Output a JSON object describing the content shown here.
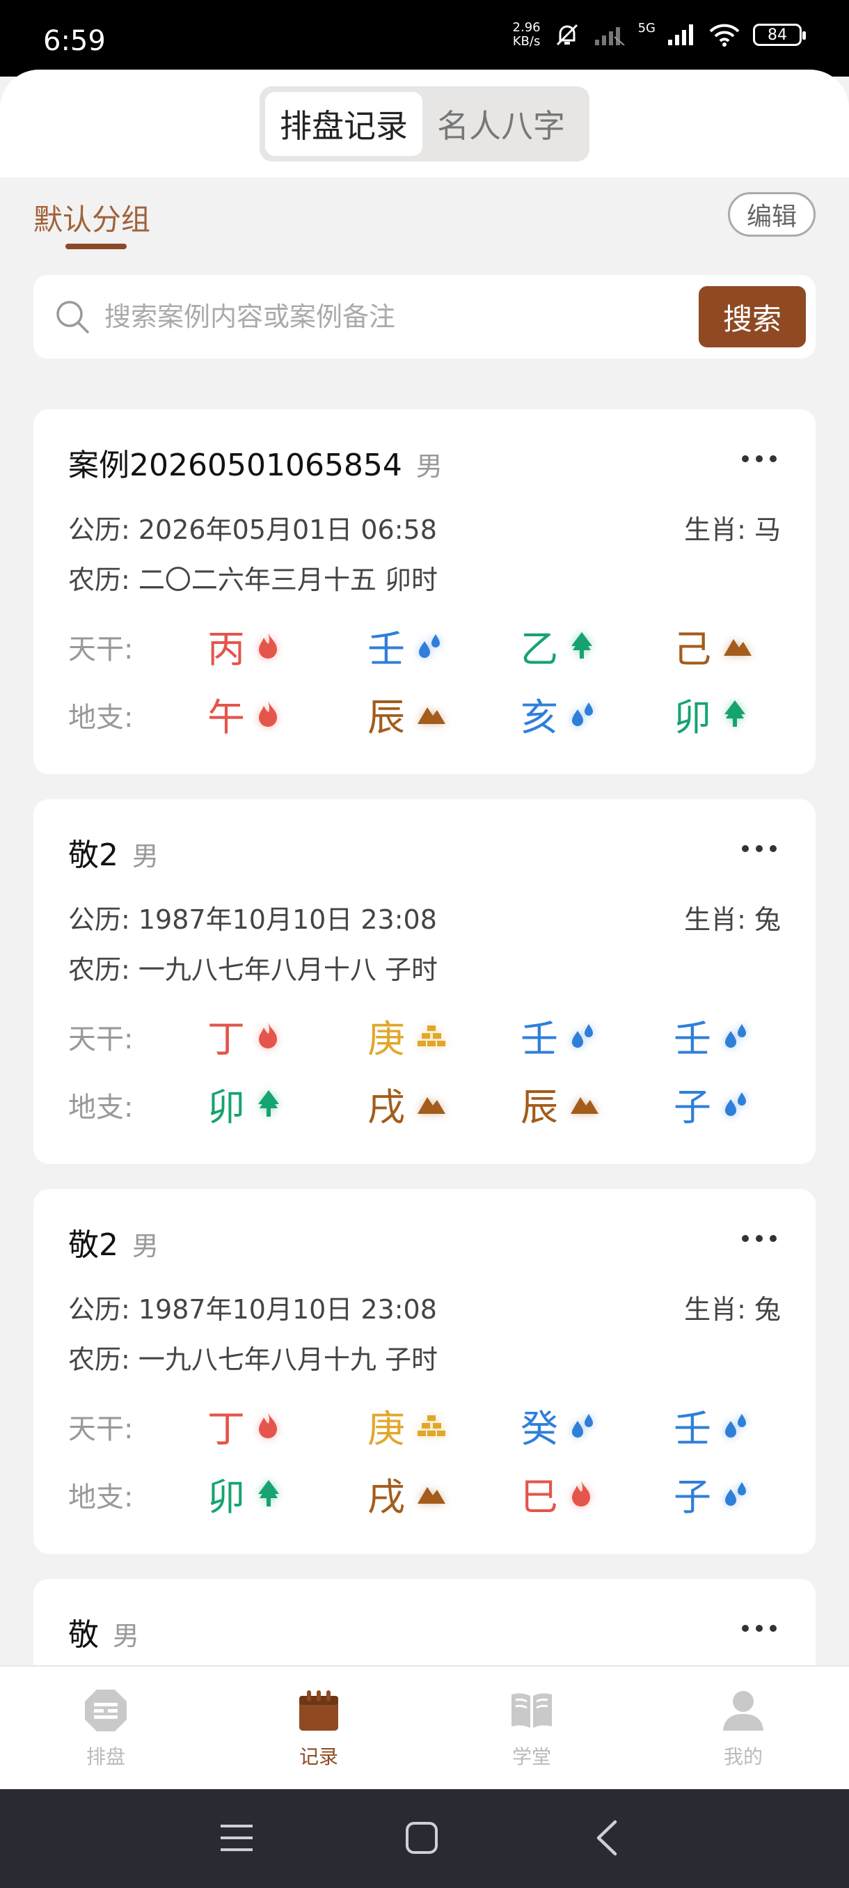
{
  "status": {
    "time": "6:59",
    "net_speed_value": "2.96",
    "net_speed_unit": "KB/s",
    "network": "5G",
    "battery": "84"
  },
  "tabs": [
    {
      "label": "排盘记录",
      "active": true
    },
    {
      "label": "名人八字",
      "active": false
    }
  ],
  "group": {
    "label": "默认分组",
    "edit_label": "编辑"
  },
  "search": {
    "placeholder": "搜索案例内容或案例备注",
    "button_label": "搜索"
  },
  "labels": {
    "gan": "天干:",
    "zhi": "地支:"
  },
  "element_colors": {
    "fire": "#e4554b",
    "water": "#2f7fd9",
    "wood": "#16a36f",
    "earth": "#a35c1c",
    "metal": "#e0a72a"
  },
  "cards": [
    {
      "title": "案例20260501065854",
      "gender": "男",
      "solar": "公历: 2026年05月01日 06:58",
      "zodiac": "生肖: 马",
      "lunar": "农历: 二〇二六年三月十五  卯时",
      "gan": [
        {
          "char": "丙",
          "el": "fire"
        },
        {
          "char": "壬",
          "el": "water"
        },
        {
          "char": "乙",
          "el": "wood"
        },
        {
          "char": "己",
          "el": "earth"
        }
      ],
      "zhi": [
        {
          "char": "午",
          "el": "fire"
        },
        {
          "char": "辰",
          "el": "earth"
        },
        {
          "char": "亥",
          "el": "water"
        },
        {
          "char": "卯",
          "el": "wood"
        }
      ]
    },
    {
      "title": "敬2",
      "gender": "男",
      "solar": "公历: 1987年10月10日 23:08",
      "zodiac": "生肖: 兔",
      "lunar": "农历: 一九八七年八月十八  子时",
      "gan": [
        {
          "char": "丁",
          "el": "fire"
        },
        {
          "char": "庚",
          "el": "metal"
        },
        {
          "char": "壬",
          "el": "water"
        },
        {
          "char": "壬",
          "el": "water"
        }
      ],
      "zhi": [
        {
          "char": "卯",
          "el": "wood"
        },
        {
          "char": "戌",
          "el": "earth"
        },
        {
          "char": "辰",
          "el": "earth"
        },
        {
          "char": "子",
          "el": "water"
        }
      ]
    },
    {
      "title": "敬2",
      "gender": "男",
      "solar": "公历: 1987年10月10日 23:08",
      "zodiac": "生肖: 兔",
      "lunar": "农历: 一九八七年八月十九  子时",
      "gan": [
        {
          "char": "丁",
          "el": "fire"
        },
        {
          "char": "庚",
          "el": "metal"
        },
        {
          "char": "癸",
          "el": "water"
        },
        {
          "char": "壬",
          "el": "water"
        }
      ],
      "zhi": [
        {
          "char": "卯",
          "el": "wood"
        },
        {
          "char": "戌",
          "el": "earth"
        },
        {
          "char": "巳",
          "el": "fire"
        },
        {
          "char": "子",
          "el": "water"
        }
      ]
    },
    {
      "title": "敬",
      "gender": "男"
    }
  ],
  "tabbar": [
    {
      "label": "排盘",
      "icon": "paipan-icon",
      "active": false
    },
    {
      "label": "记录",
      "icon": "calendar-icon",
      "active": true
    },
    {
      "label": "学堂",
      "icon": "book-icon",
      "active": false
    },
    {
      "label": "我的",
      "icon": "user-icon",
      "active": false
    }
  ]
}
